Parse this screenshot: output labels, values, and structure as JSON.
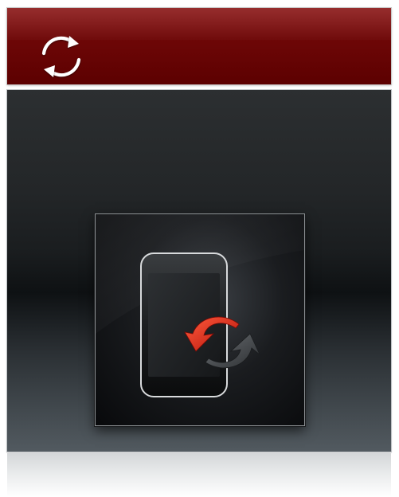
{
  "header": {
    "sync_icon": "sync-icon",
    "accent_color": "#6b0505"
  },
  "main": {
    "tile_icon": "phone-sync-icon",
    "arrow_colors": {
      "primary": "#d9281a",
      "secondary": "#4a4d50"
    }
  }
}
